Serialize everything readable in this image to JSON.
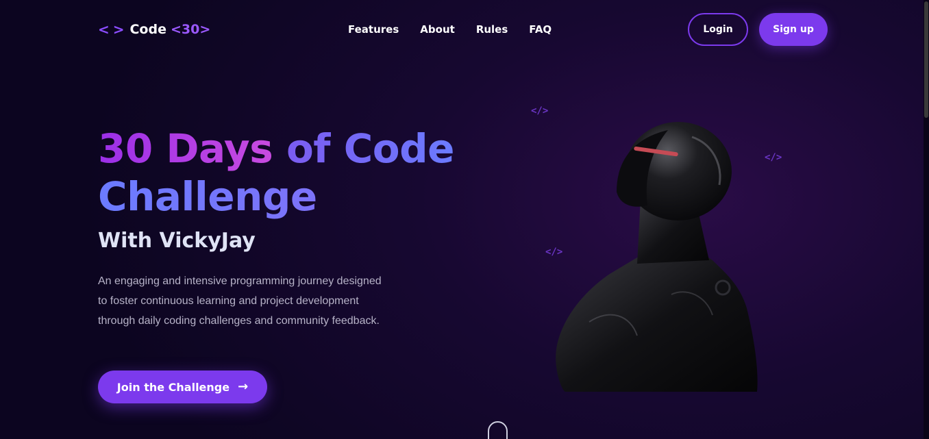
{
  "logo": {
    "icon": "< >",
    "icon_name": "code-brackets-icon",
    "text": "Code",
    "accent": "<30>"
  },
  "nav": {
    "links": [
      "Features",
      "About",
      "Rules",
      "FAQ"
    ],
    "login_label": "Login",
    "signup_label": "Sign up"
  },
  "hero": {
    "title_part1": "30 Days",
    "title_part2": "of Code",
    "title_part3": "Challenge",
    "subtitle": "With VickyJay",
    "description": "An engaging and intensive programming journey designed to foster continuous learning and project development through daily coding challenges and community feedback.",
    "cta_label": "Join the Challenge",
    "cta_icon": "arrow-right-icon"
  },
  "decor": {
    "code_tag": "</>"
  },
  "colors": {
    "accent": "#7c3aed",
    "background": "#170831",
    "gradient_pink": "#c84be0",
    "gradient_blue": "#6b7bff"
  }
}
